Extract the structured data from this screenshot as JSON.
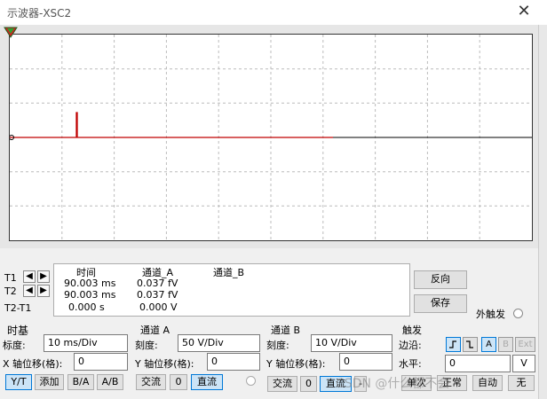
{
  "window": {
    "title": "示波器-XSC2",
    "close": "✕"
  },
  "colors": {
    "grid": "#c8c8c8",
    "trace_a": "#c00000",
    "trace_b": "#000000",
    "accent": "#0078d7"
  },
  "readout": {
    "t1": "T1",
    "t2": "T2",
    "t2t1": "T2-T1",
    "col_time": "时间",
    "col_a": "通道_A",
    "col_b": "通道_B",
    "rows": [
      {
        "time": "90.003 ms",
        "a": "0.037 fV",
        "b": ""
      },
      {
        "time": "90.003 ms",
        "a": "0.037 fV",
        "b": ""
      },
      {
        "time": "0.000 s",
        "a": "0.000 V",
        "b": ""
      }
    ]
  },
  "side_buttons": {
    "reverse": "反向",
    "save": "保存",
    "ext_trigger": "外触发"
  },
  "timebase": {
    "title": "时基",
    "scale_label": "标度:",
    "scale_value": "10 ms/Div",
    "xpos_label": "X 轴位移(格):",
    "xpos_value": "0",
    "modes": [
      "Y/T",
      "添加",
      "B/A",
      "A/B"
    ]
  },
  "channel_a": {
    "title": "通道 A",
    "scale_label": "刻度:",
    "scale_value": "50  V/Div",
    "ypos_label": "Y 轴位移(格):",
    "ypos_value": "0",
    "coupling": [
      "交流",
      "0",
      "直流"
    ]
  },
  "channel_b": {
    "title": "通道 B",
    "scale_label": "刻度:",
    "scale_value": "10  V/Div",
    "ypos_label": "Y 轴位移(格):",
    "ypos_value": "0",
    "coupling": [
      "交流",
      "0",
      "直流",
      "-"
    ]
  },
  "trigger": {
    "title": "触发",
    "edge_label": "边沿:",
    "level_label": "水平:",
    "level_value": "0",
    "level_unit": "V",
    "sources": [
      "A",
      "B",
      "Ext"
    ],
    "modes": [
      "单次",
      "正常",
      "自动",
      "无"
    ]
  },
  "watermark": "CSDN @什么都不会"
}
